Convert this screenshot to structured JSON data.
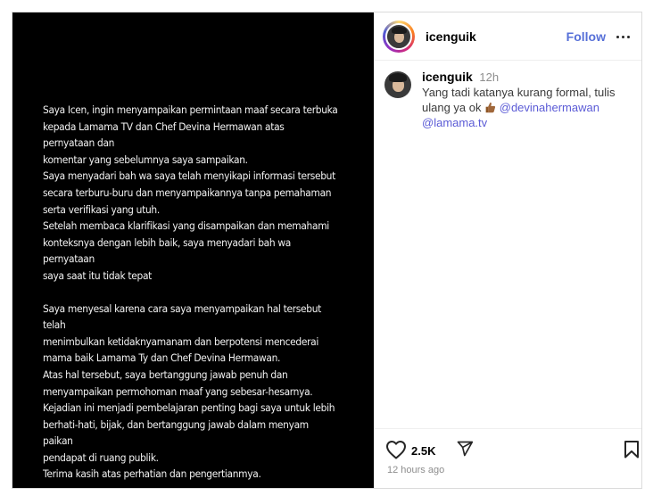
{
  "media": {
    "paragraphs": [
      "Saya Icen, ingin menyampaikan permintaan maaf secara terbuka\nkepada Lamama TV dan Chef Devina Hermawan atas pernyataan dan\nkomentar yang sebelumnya saya sampaikan.\nSaya menyadari bah wa saya telah menyikapi informasi tersebut\nsecara terburu-buru dan menyampaikannya tanpa pemahaman\nserta verifikasi yang utuh.\nSetelah membaca klarifikasi yang disampaikan dan memahami\nkonteksnya dengan lebih baik, saya menyadari bah wa pernyataan\nsaya saat itu tidak tepat",
      "Saya menyesal karena cara saya menyampaikan hal tersebut telah\nmenimbulkan ketidaknyamanam dan berpotensi mencederai\nmama baik Lamama Ty dan Chef Devina Hermawan.\nAtas hal tersebut, saya bertanggung jawab penuh dan\nmenyampaikan permohoman maaf yang sebesar-hesarnya.\nKejadian ini menjadi pembelajaran penting bagi saya untuk lebih\nberhati-hati, bijak, dan bertanggung jawab dalam menyam paikan\npendapat di ruang publik.\nTerima kasih atas perhatian dan pengertianmya."
    ]
  },
  "header": {
    "username": "icenguik",
    "follow_label": "Follow",
    "icons": [
      "avatar",
      "more-options-icon"
    ]
  },
  "caption": {
    "username": "icenguik",
    "time": "12h",
    "text": "Yang tadi katanya kurang formal, tulis ulang ya ok",
    "emoji": "thumbs-up",
    "mentions": [
      "@devinahermawan",
      "@lamama.tv"
    ]
  },
  "actions": {
    "likes": "2.5K",
    "timestamp": "12 hours ago",
    "icons": [
      "heart-icon",
      "share-icon",
      "bookmark-icon"
    ]
  }
}
